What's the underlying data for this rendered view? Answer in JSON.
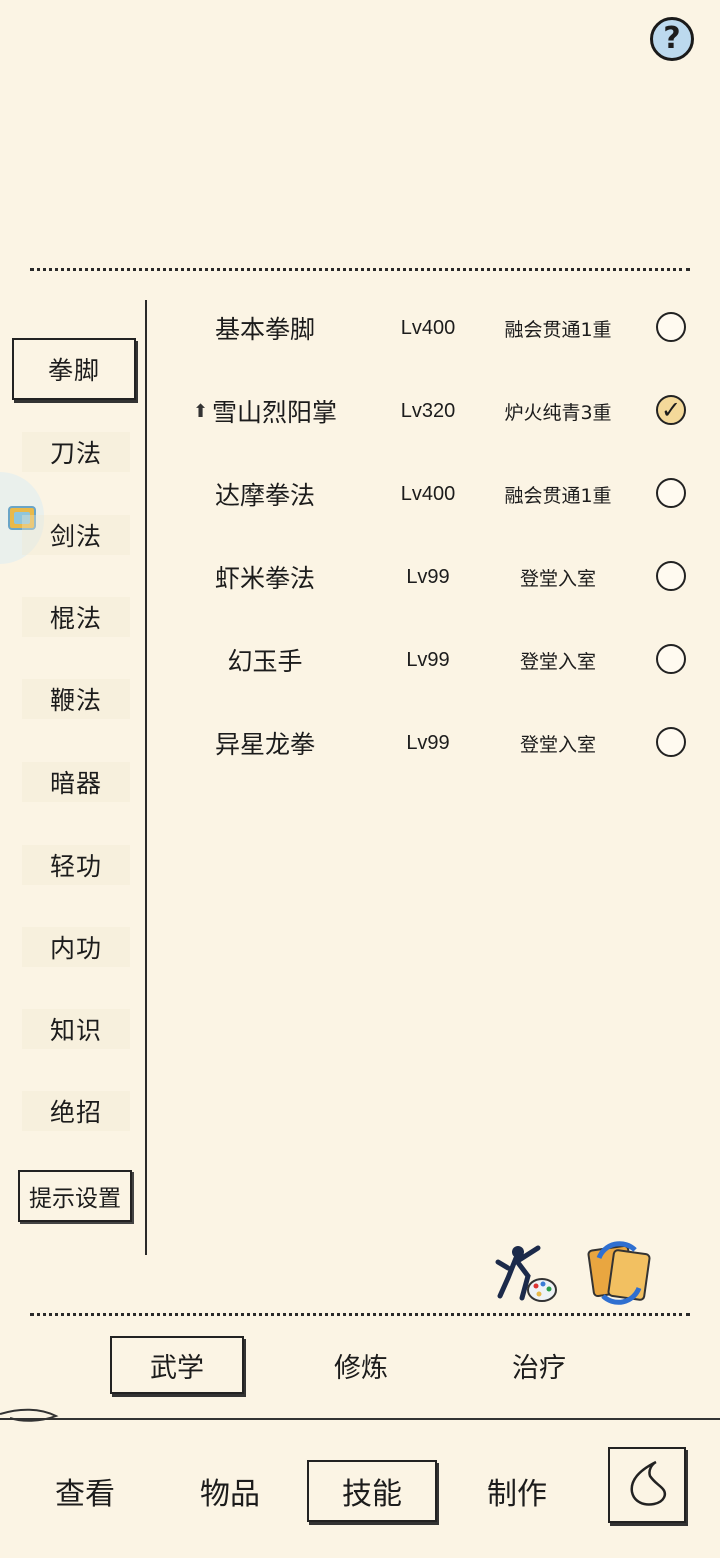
{
  "help": {
    "glyph": "?"
  },
  "side_tabs": [
    {
      "label": "拳脚",
      "active": true
    },
    {
      "label": "刀法"
    },
    {
      "label": "剑法"
    },
    {
      "label": "棍法"
    },
    {
      "label": "鞭法"
    },
    {
      "label": "暗器"
    },
    {
      "label": "轻功"
    },
    {
      "label": "内功"
    },
    {
      "label": "知识"
    },
    {
      "label": "绝招"
    }
  ],
  "tip_settings": "提示设置",
  "skills": [
    {
      "name": "基本拳脚",
      "level": "Lv400",
      "stage": "融会贯通1重",
      "checked": false
    },
    {
      "name": "雪山烈阳掌",
      "level": "Lv320",
      "stage": "炉火纯青3重",
      "checked": true,
      "upgrade_icon": "up-arrow-icon"
    },
    {
      "name": "达摩拳法",
      "level": "Lv400",
      "stage": "融会贯通1重",
      "checked": false
    },
    {
      "name": "虾米拳法",
      "level": "Lv99",
      "stage": "登堂入室",
      "checked": false
    },
    {
      "name": "幻玉手",
      "level": "Lv99",
      "stage": "登堂入室",
      "checked": false
    },
    {
      "name": "异星龙拳",
      "level": "Lv99",
      "stage": "登堂入室",
      "checked": false
    }
  ],
  "check_glyph": "✓",
  "up_glyph": "⬆",
  "sub_tabs": [
    {
      "label": "武学",
      "active": true
    },
    {
      "label": "修炼"
    },
    {
      "label": "治疗"
    }
  ],
  "bottom_tabs": [
    {
      "label": "查看"
    },
    {
      "label": "物品"
    },
    {
      "label": "技能",
      "active": true
    },
    {
      "label": "制作"
    }
  ],
  "colors": {
    "background": "#fbf4e4",
    "ink": "#1c1c1c",
    "help_fill": "#bcd9ee",
    "check_fill": "#f4d99a"
  }
}
